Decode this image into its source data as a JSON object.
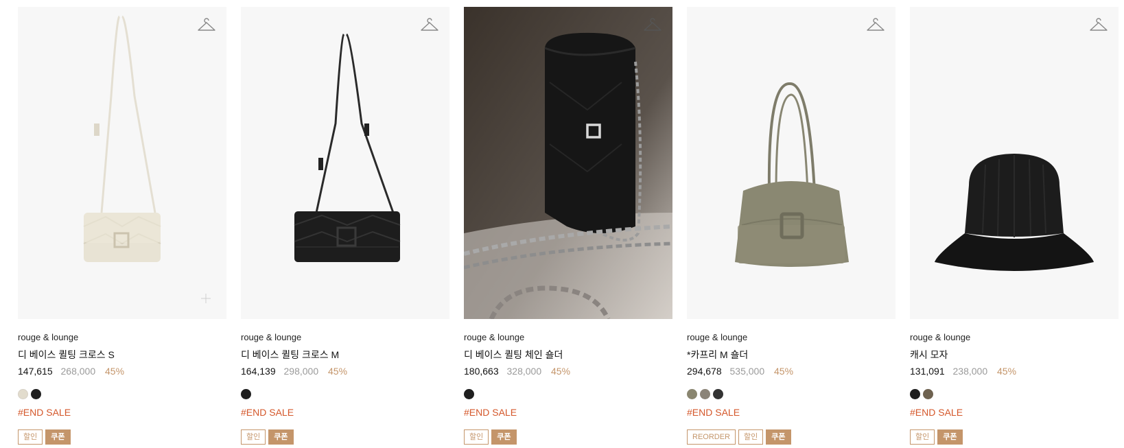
{
  "products": [
    {
      "brand": "rouge & lounge",
      "name": "디 베이스 퀼팅 크로스 S",
      "price": "147,615",
      "original_price": "268,000",
      "discount": "45%",
      "swatches": [
        "#e2dccd",
        "#1f1f1f"
      ],
      "tag": "#END SALE",
      "badges": [
        {
          "label": "할인",
          "style": "outline"
        },
        {
          "label": "쿠폰",
          "style": "fill"
        }
      ]
    },
    {
      "brand": "rouge & lounge",
      "name": "디 베이스 퀼팅 크로스 M",
      "price": "164,139",
      "original_price": "298,000",
      "discount": "45%",
      "swatches": [
        "#1f1f1f"
      ],
      "tag": "#END SALE",
      "badges": [
        {
          "label": "할인",
          "style": "outline"
        },
        {
          "label": "쿠폰",
          "style": "fill"
        }
      ]
    },
    {
      "brand": "rouge & lounge",
      "name": "디 베이스 퀼팅 체인 숄더",
      "price": "180,663",
      "original_price": "328,000",
      "discount": "45%",
      "swatches": [
        "#1f1f1f"
      ],
      "tag": "#END SALE",
      "badges": [
        {
          "label": "할인",
          "style": "outline"
        },
        {
          "label": "쿠폰",
          "style": "fill"
        }
      ]
    },
    {
      "brand": "rouge & lounge",
      "name": "*카프리 M 숄더",
      "price": "294,678",
      "original_price": "535,000",
      "discount": "45%",
      "swatches": [
        "#8a8670",
        "#8b8478",
        "#333333"
      ],
      "tag": "#END SALE",
      "badges": [
        {
          "label": "REORDER",
          "style": "outline"
        },
        {
          "label": "할인",
          "style": "outline"
        },
        {
          "label": "쿠폰",
          "style": "fill"
        }
      ]
    },
    {
      "brand": "rouge & lounge",
      "name": "캐시 모자",
      "price": "131,091",
      "original_price": "238,000",
      "discount": "45%",
      "swatches": [
        "#1f1f1f",
        "#6e6250"
      ],
      "tag": "#END SALE",
      "badges": [
        {
          "label": "할인",
          "style": "outline"
        },
        {
          "label": "쿠폰",
          "style": "fill"
        }
      ]
    }
  ],
  "icons": {
    "wishlist": "hanger-icon",
    "add": "plus-icon"
  },
  "colors": {
    "accent": "#c4956a",
    "sale_tag": "#d4572a",
    "muted_price": "#9a9a9a",
    "image_bg": "#f7f7f7"
  }
}
